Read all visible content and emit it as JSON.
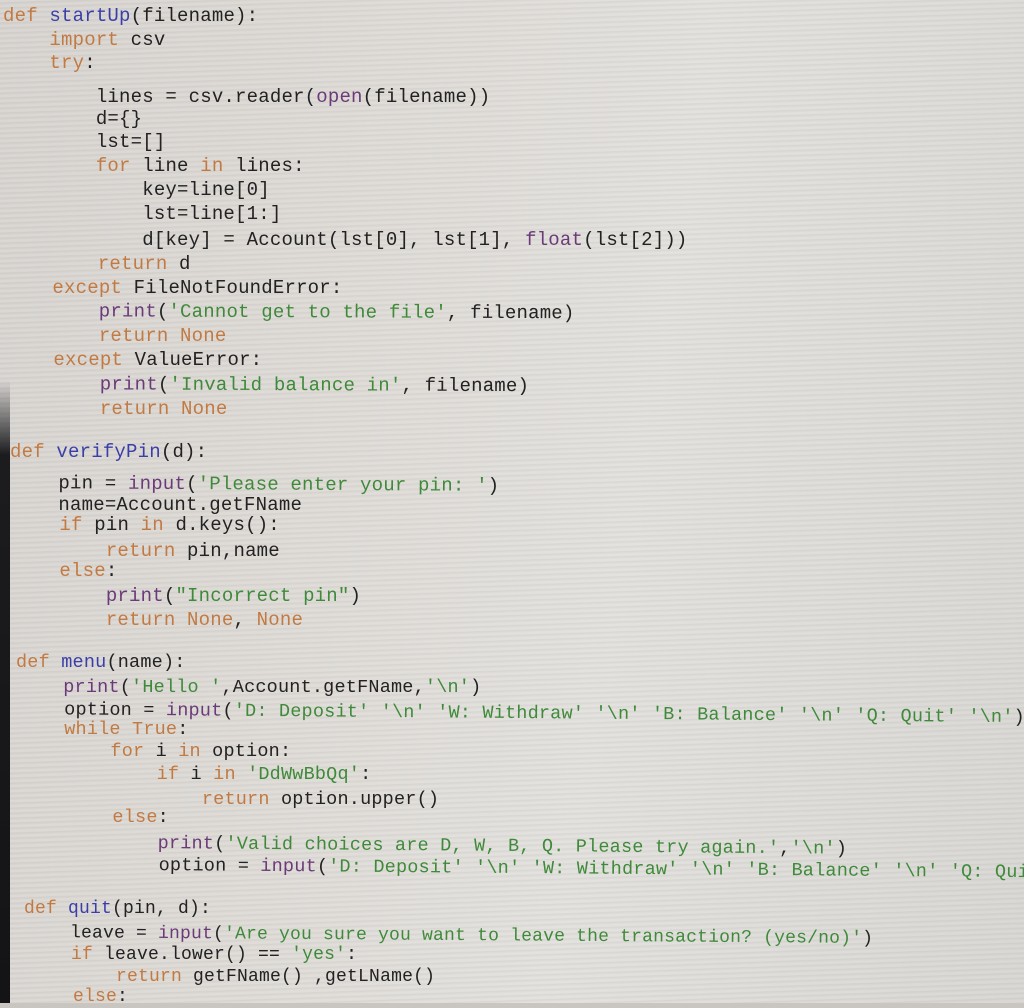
{
  "editor": {
    "language": "python",
    "colors": {
      "keyword": "#c27a43",
      "definition": "#3a3fa8",
      "string": "#3f8a3a",
      "builtin": "#6b3a78",
      "plain": "#222222",
      "background": "#dedbd7"
    },
    "lines": [
      {
        "tokens": [
          [
            "kw",
            "def"
          ],
          [
            "pl",
            " "
          ],
          [
            "def",
            "startUp"
          ],
          [
            "pl",
            "(filename):"
          ]
        ]
      },
      {
        "tokens": [
          [
            "pl",
            "    "
          ],
          [
            "kw",
            "import"
          ],
          [
            "pl",
            " csv"
          ]
        ]
      },
      {
        "tokens": [
          [
            "pl",
            "    "
          ],
          [
            "kw",
            "try"
          ],
          [
            "pl",
            ":"
          ]
        ]
      },
      {
        "tokens": [
          [
            "pl",
            "        lines = csv.reader("
          ],
          [
            "bi",
            "open"
          ],
          [
            "pl",
            "(filename))"
          ]
        ]
      },
      {
        "tokens": [
          [
            "pl",
            "        d={}"
          ]
        ]
      },
      {
        "tokens": [
          [
            "pl",
            "        lst=[]"
          ]
        ]
      },
      {
        "tokens": [
          [
            "pl",
            "        "
          ],
          [
            "kw",
            "for"
          ],
          [
            "pl",
            " line "
          ],
          [
            "kw",
            "in"
          ],
          [
            "pl",
            " lines:"
          ]
        ]
      },
      {
        "tokens": [
          [
            "pl",
            "            key=line[0]"
          ]
        ]
      },
      {
        "tokens": [
          [
            "pl",
            "            lst=line[1:]"
          ]
        ]
      },
      {
        "tokens": [
          [
            "pl",
            "            d[key] = Account(lst[0], lst[1], "
          ],
          [
            "bi",
            "float"
          ],
          [
            "pl",
            "(lst[2]))"
          ]
        ]
      },
      {
        "tokens": [
          [
            "pl",
            "        "
          ],
          [
            "kw",
            "return"
          ],
          [
            "pl",
            " d"
          ]
        ]
      },
      {
        "tokens": [
          [
            "pl",
            "    "
          ],
          [
            "kw",
            "except"
          ],
          [
            "pl",
            " FileNotFoundError:"
          ]
        ]
      },
      {
        "tokens": [
          [
            "pl",
            "        "
          ],
          [
            "bi",
            "print"
          ],
          [
            "pl",
            "("
          ],
          [
            "str",
            "'Cannot get to the file'"
          ],
          [
            "pl",
            ", filename)"
          ]
        ]
      },
      {
        "tokens": [
          [
            "pl",
            "        "
          ],
          [
            "kw",
            "return None"
          ]
        ]
      },
      {
        "tokens": [
          [
            "pl",
            "    "
          ],
          [
            "kw",
            "except"
          ],
          [
            "pl",
            " ValueError:"
          ]
        ]
      },
      {
        "tokens": [
          [
            "pl",
            "        "
          ],
          [
            "bi",
            "print"
          ],
          [
            "pl",
            "("
          ],
          [
            "str",
            "'Invalid balance in'"
          ],
          [
            "pl",
            ", filename)"
          ]
        ]
      },
      {
        "tokens": [
          [
            "pl",
            "        "
          ],
          [
            "kw",
            "return None"
          ]
        ]
      },
      {
        "tokens": [
          [
            "pl",
            ""
          ]
        ]
      },
      {
        "tokens": [
          [
            "kw",
            "def"
          ],
          [
            "pl",
            " "
          ],
          [
            "def",
            "verifyPin"
          ],
          [
            "pl",
            "(d):"
          ]
        ]
      },
      {
        "tokens": [
          [
            "pl",
            "    pin = "
          ],
          [
            "bi",
            "input"
          ],
          [
            "pl",
            "("
          ],
          [
            "str",
            "'Please enter your pin: '"
          ],
          [
            "pl",
            ")"
          ]
        ]
      },
      {
        "tokens": [
          [
            "pl",
            "    name=Account.getFName"
          ]
        ]
      },
      {
        "tokens": [
          [
            "pl",
            "    "
          ],
          [
            "kw",
            "if"
          ],
          [
            "pl",
            " pin "
          ],
          [
            "kw",
            "in"
          ],
          [
            "pl",
            " d.keys():"
          ]
        ]
      },
      {
        "tokens": [
          [
            "pl",
            "        "
          ],
          [
            "kw",
            "return"
          ],
          [
            "pl",
            " pin,name"
          ]
        ]
      },
      {
        "tokens": [
          [
            "pl",
            "    "
          ],
          [
            "kw",
            "else"
          ],
          [
            "pl",
            ":"
          ]
        ]
      },
      {
        "tokens": [
          [
            "pl",
            "        "
          ],
          [
            "bi",
            "print"
          ],
          [
            "pl",
            "("
          ],
          [
            "str",
            "\"Incorrect pin\""
          ],
          [
            "pl",
            ")"
          ]
        ]
      },
      {
        "tokens": [
          [
            "pl",
            "        "
          ],
          [
            "kw",
            "return None"
          ],
          [
            "pl",
            ", "
          ],
          [
            "kw",
            "None"
          ]
        ]
      },
      {
        "tokens": [
          [
            "pl",
            ""
          ]
        ]
      },
      {
        "tokens": [
          [
            "kw",
            "def"
          ],
          [
            "pl",
            " "
          ],
          [
            "def",
            "menu"
          ],
          [
            "pl",
            "(name):"
          ]
        ]
      },
      {
        "tokens": [
          [
            "pl",
            "    "
          ],
          [
            "bi",
            "print"
          ],
          [
            "pl",
            "("
          ],
          [
            "str",
            "'Hello '"
          ],
          [
            "pl",
            ",Account.getFName,"
          ],
          [
            "str",
            "'\\n'"
          ],
          [
            "pl",
            ")"
          ]
        ]
      },
      {
        "tokens": [
          [
            "pl",
            "    option = "
          ],
          [
            "bi",
            "input"
          ],
          [
            "pl",
            "("
          ],
          [
            "str",
            "'D: Deposit' '\\n' 'W: Withdraw' '\\n' 'B: Balance' '\\n' 'Q: Quit' '\\n'"
          ],
          [
            "pl",
            ")"
          ]
        ]
      },
      {
        "tokens": [
          [
            "pl",
            "    "
          ],
          [
            "kw",
            "while True"
          ],
          [
            "pl",
            ":"
          ]
        ]
      },
      {
        "tokens": [
          [
            "pl",
            "        "
          ],
          [
            "kw",
            "for"
          ],
          [
            "pl",
            " i "
          ],
          [
            "kw",
            "in"
          ],
          [
            "pl",
            " option:"
          ]
        ]
      },
      {
        "tokens": [
          [
            "pl",
            "            "
          ],
          [
            "kw",
            "if"
          ],
          [
            "pl",
            " i "
          ],
          [
            "kw",
            "in"
          ],
          [
            "pl",
            " "
          ],
          [
            "str",
            "'DdWwBbQq'"
          ],
          [
            "pl",
            ":"
          ]
        ]
      },
      {
        "tokens": [
          [
            "pl",
            "                "
          ],
          [
            "kw",
            "return"
          ],
          [
            "pl",
            " option.upper()"
          ]
        ]
      },
      {
        "tokens": [
          [
            "pl",
            "        "
          ],
          [
            "kw",
            "else"
          ],
          [
            "pl",
            ":"
          ]
        ]
      },
      {
        "tokens": [
          [
            "pl",
            "            "
          ],
          [
            "bi",
            "print"
          ],
          [
            "pl",
            "("
          ],
          [
            "str",
            "'Valid choices are D, W, B, Q. Please try again.'"
          ],
          [
            "pl",
            ","
          ],
          [
            "str",
            "'\\n'"
          ],
          [
            "pl",
            ")"
          ]
        ]
      },
      {
        "tokens": [
          [
            "pl",
            "            option = "
          ],
          [
            "bi",
            "input"
          ],
          [
            "pl",
            "("
          ],
          [
            "str",
            "'D: Deposit' '\\n' 'W: Withdraw' '\\n' 'B: Balance' '\\n' 'Q: Quit"
          ]
        ]
      },
      {
        "tokens": [
          [
            "pl",
            ""
          ]
        ]
      },
      {
        "tokens": [
          [
            "kw",
            "def"
          ],
          [
            "pl",
            " "
          ],
          [
            "def",
            "quit"
          ],
          [
            "pl",
            "(pin, d):"
          ]
        ]
      },
      {
        "tokens": [
          [
            "pl",
            "    leave = "
          ],
          [
            "bi",
            "input"
          ],
          [
            "pl",
            "("
          ],
          [
            "str",
            "'Are you sure you want to leave the transaction? (yes/no)'"
          ],
          [
            "pl",
            ")"
          ]
        ]
      },
      {
        "tokens": [
          [
            "pl",
            "    "
          ],
          [
            "kw",
            "if"
          ],
          [
            "pl",
            " leave.lower() == "
          ],
          [
            "str",
            "'yes'"
          ],
          [
            "pl",
            ":"
          ]
        ]
      },
      {
        "tokens": [
          [
            "pl",
            "        "
          ],
          [
            "kw",
            "return"
          ],
          [
            "pl",
            " getFName() ,getLName()"
          ]
        ]
      },
      {
        "tokens": [
          [
            "pl",
            "    "
          ],
          [
            "kw",
            "else"
          ],
          [
            "pl",
            ":"
          ]
        ]
      }
    ]
  }
}
